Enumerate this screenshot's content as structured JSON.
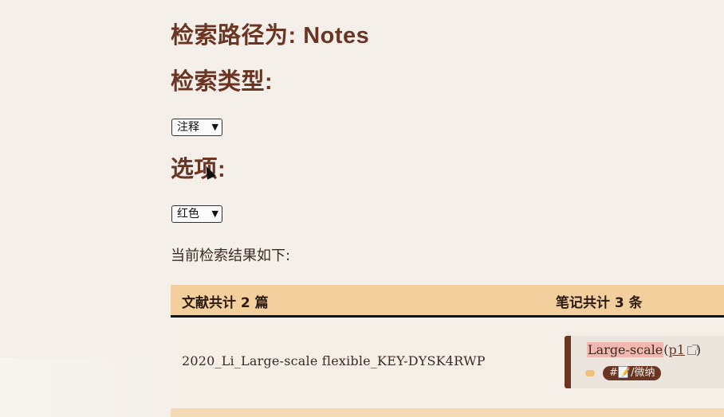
{
  "search": {
    "path_heading": "检索路径为: Notes",
    "type_heading": "检索类型:",
    "type_value": "注释",
    "option_heading": "选项:",
    "option_value": "红色",
    "result_label": "当前检索结果如下:"
  },
  "table": {
    "doc_count_label": "文献共计 2 篇",
    "note_count_label": "笔记共计 3 条",
    "rows": [
      {
        "doc_title": "2020_Li_Large-scale flexible_KEY-DYSK4RWP",
        "note": {
          "highlight_text": "Large-scale",
          "page_open": "(",
          "page_link": "p1",
          "page_close": ")",
          "tag_label": "#📝/微纳",
          "tag_color": "#f3c07a",
          "card_accent": "#6b3524"
        }
      }
    ]
  },
  "icons": {
    "select_chevron": "chevron-down-icon",
    "external_link": "external-link-icon",
    "cursor": "mouse-cursor-icon"
  },
  "colors": {
    "background": "#f4efe9",
    "heading": "#6b3524",
    "table_header": "#f2cf9c",
    "highlight": "#f2b8b0"
  }
}
